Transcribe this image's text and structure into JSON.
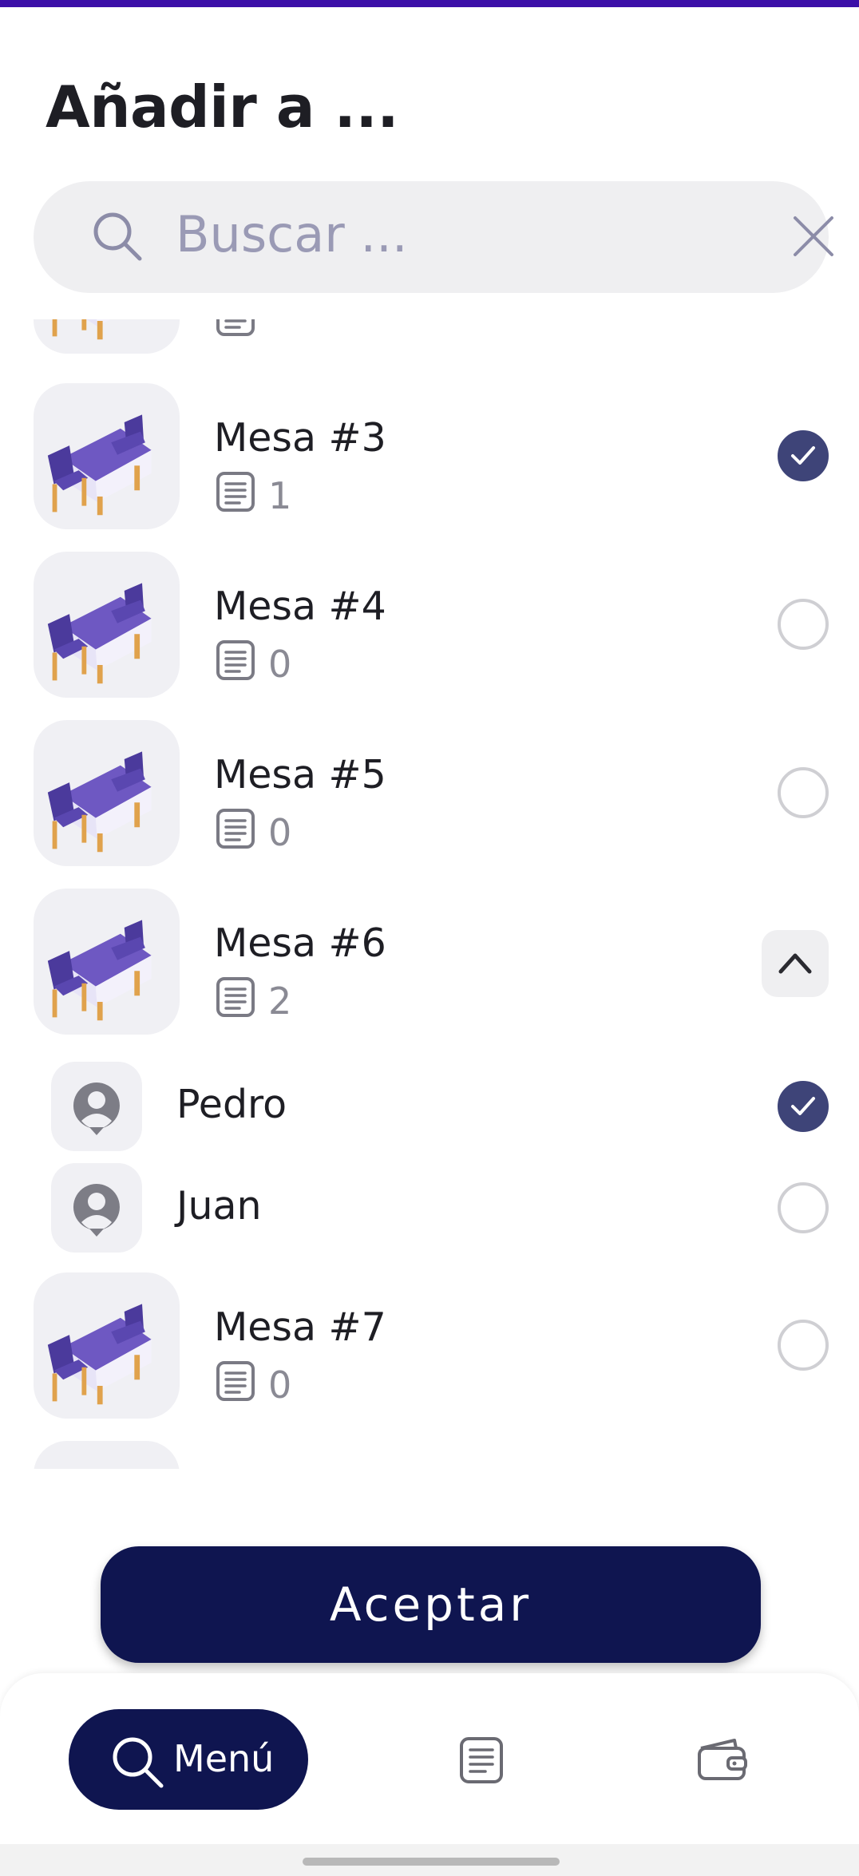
{
  "header": {
    "title": "Añadir a ..."
  },
  "search": {
    "placeholder": "Buscar ..."
  },
  "tables": [
    {
      "name": "Mesa #3",
      "orders": "1",
      "selected": true
    },
    {
      "name": "Mesa #4",
      "orders": "0",
      "selected": false
    },
    {
      "name": "Mesa #5",
      "orders": "0",
      "selected": false
    },
    {
      "name": "Mesa #6",
      "orders": "2",
      "expanded": true,
      "diners": [
        {
          "name": "Pedro",
          "selected": true
        },
        {
          "name": "Juan",
          "selected": false
        }
      ]
    },
    {
      "name": "Mesa #7",
      "orders": "0",
      "selected": false
    }
  ],
  "actions": {
    "accept_label": "Aceptar"
  },
  "nav": {
    "menu_label": "Menú",
    "active": "menu"
  },
  "colors": {
    "accent": "#0f1550",
    "check": "#3e4478",
    "topbar": "#3c0fa8",
    "table_top": "#6e58c2"
  },
  "icons": {
    "search": "search-icon",
    "clear": "close-icon",
    "orders": "receipt-icon",
    "wallet": "wallet-icon",
    "diner": "user-icon",
    "table": "table-icon"
  }
}
